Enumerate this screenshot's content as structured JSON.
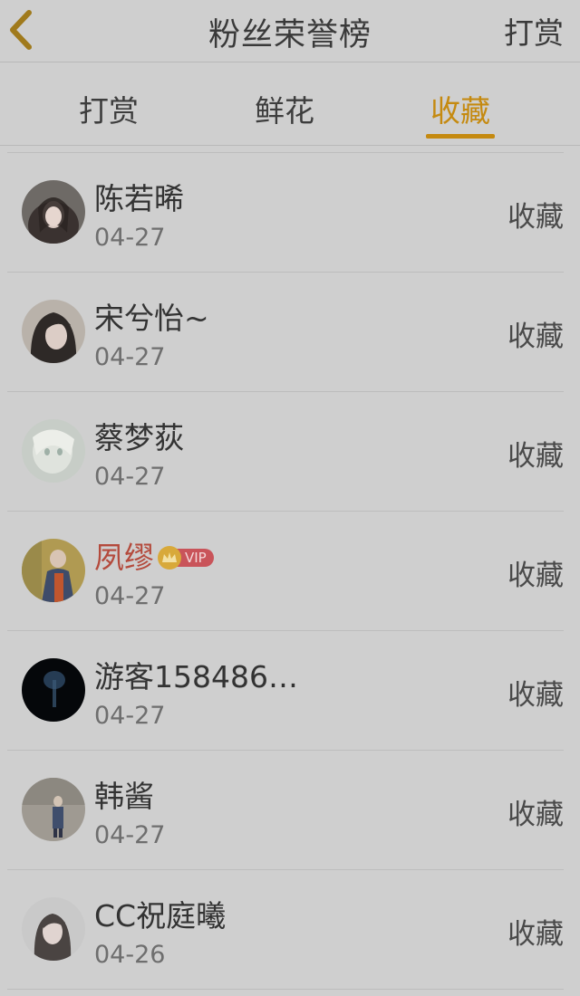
{
  "header": {
    "title": "粉丝荣誉榜",
    "action_label": "打赏"
  },
  "tabs": [
    {
      "label": "打赏",
      "active": false
    },
    {
      "label": "鲜花",
      "active": false
    },
    {
      "label": "收藏",
      "active": true
    }
  ],
  "colors": {
    "accent": "#c58a10",
    "vip_name": "#b44a3c",
    "vip_badge": "#c9545a"
  },
  "fans": [
    {
      "name": "陈若晞",
      "date": "04-27",
      "action": "收藏",
      "vip": false
    },
    {
      "name": "宋兮怡~",
      "date": "04-27",
      "action": "收藏",
      "vip": false
    },
    {
      "name": "蔡梦荻",
      "date": "04-27",
      "action": "收藏",
      "vip": false
    },
    {
      "name": "夙缪",
      "date": "04-27",
      "action": "收藏",
      "vip": true,
      "badge": "VIP"
    },
    {
      "name": "游客158486…",
      "date": "04-27",
      "action": "收藏",
      "vip": false
    },
    {
      "name": "韩酱",
      "date": "04-27",
      "action": "收藏",
      "vip": false
    },
    {
      "name": "CC祝庭曦",
      "date": "04-26",
      "action": "收藏",
      "vip": false
    }
  ]
}
